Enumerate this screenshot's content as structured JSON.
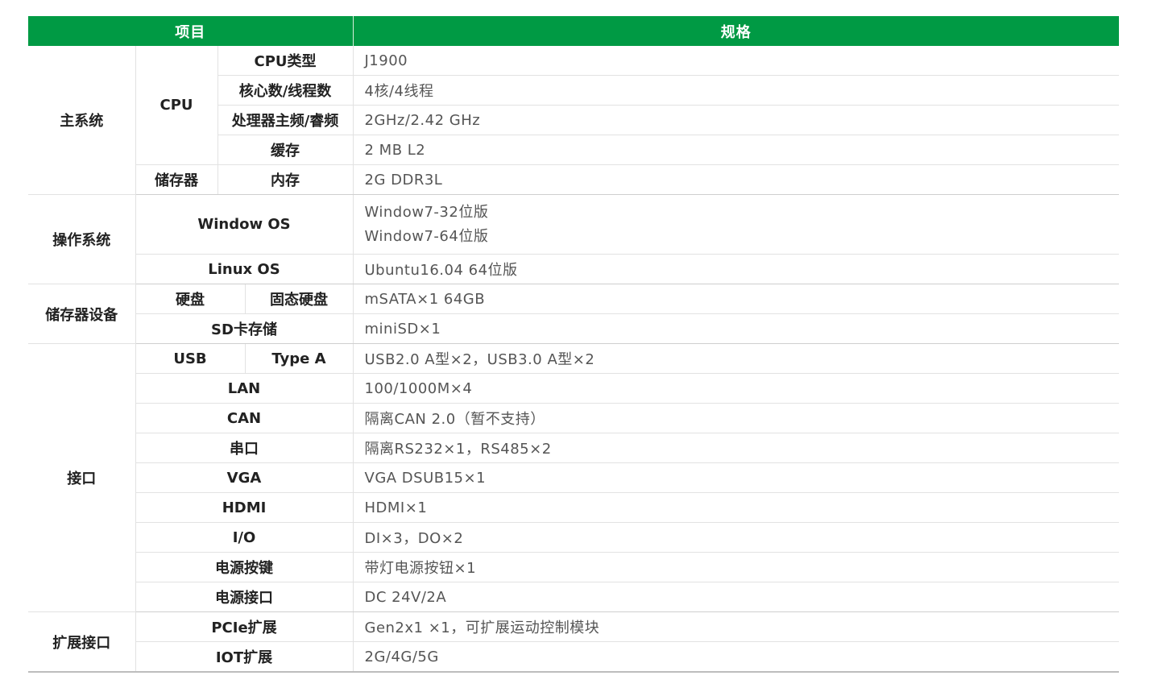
{
  "header": {
    "item": "项目",
    "spec": "规格"
  },
  "groups": {
    "main_system": "主系统",
    "os": "操作系统",
    "storage_device": "储存器设备",
    "interface": "接口",
    "expansion": "扩展接口"
  },
  "sub": {
    "cpu": "CPU",
    "memory_group": "储存器",
    "windows": "Window OS",
    "linux": "Linux OS",
    "disk": "硬盘",
    "usb": "USB"
  },
  "rows": {
    "cpu_type": {
      "label": "CPU类型",
      "value": "J1900"
    },
    "cores": {
      "label": "核心数/线程数",
      "value": "4核/4线程"
    },
    "freq": {
      "label": "处理器主频/睿频",
      "value": "2GHz/2.42 GHz"
    },
    "cache": {
      "label": "缓存",
      "value": "2 MB L2"
    },
    "ram": {
      "label": "内存",
      "value": "2G  DDR3L"
    },
    "win_values": [
      "Window7-32位版",
      "Window7-64位版"
    ],
    "linux_value": "Ubuntu16.04 64位版",
    "ssd": {
      "label": "固态硬盘",
      "value": "mSATA×1 64GB"
    },
    "sd": {
      "label": "SD卡存储",
      "value": "miniSD×1"
    },
    "usb_type": {
      "label": "Type A",
      "value": "USB2.0 A型×2，USB3.0 A型×2"
    },
    "lan": {
      "label": "LAN",
      "value": "100/1000M×4"
    },
    "can": {
      "label": "CAN",
      "value": "隔离CAN 2.0（暂不支持）"
    },
    "serial": {
      "label": "串口",
      "value": "隔离RS232×1，RS485×2"
    },
    "vga": {
      "label": "VGA",
      "value": "VGA DSUB15×1"
    },
    "hdmi": {
      "label": "HDMI",
      "value": "HDMI×1"
    },
    "io": {
      "label": "I/O",
      "value": "DI×3，DO×2"
    },
    "power_btn": {
      "label": "电源按键",
      "value": "带灯电源按钮×1"
    },
    "power_port": {
      "label": "电源接口",
      "value": "DC 24V/2A"
    },
    "pcie": {
      "label": "PCIe扩展",
      "value": "Gen2x1 ×1，可扩展运动控制模块"
    },
    "iot": {
      "label": "IOT扩展",
      "value": "2G/4G/5G"
    }
  }
}
